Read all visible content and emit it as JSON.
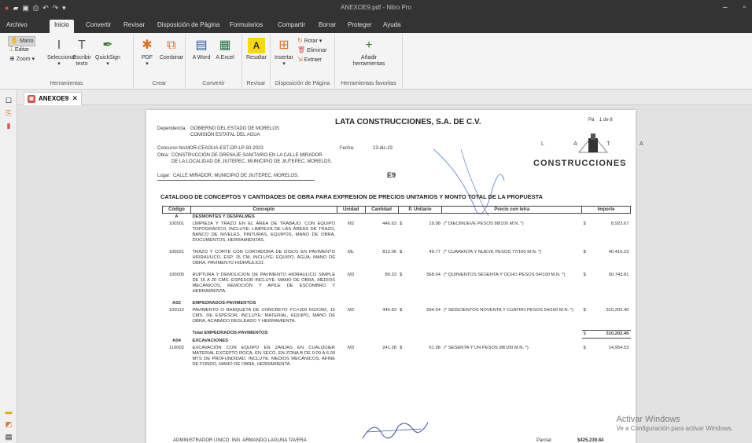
{
  "window": {
    "title": "ANEXOE9.pdf - Nitro Pro",
    "controls": [
      "–",
      "ꟸ",
      "✕"
    ]
  },
  "menu_tabs": [
    "Archivo",
    "Inicio",
    "Convertir",
    "Revisar",
    "Disposición de Página",
    "Formularios",
    "Compartir",
    "Borrar",
    "Proteger",
    "Ayuda"
  ],
  "ribbon": {
    "herramientas": {
      "label": "Herramientas",
      "mano": "Mano",
      "editar": "Editar",
      "zoom": "Zoom",
      "seleccionar": "Seleccionar",
      "escribir_texto": "Escribir texto",
      "quicksign": "QuickSign"
    },
    "crear": {
      "label": "Crear",
      "pdf": "PDF",
      "combinar": "Combinar"
    },
    "convertir": {
      "label": "Convertir",
      "a_word": "A Word",
      "a_excel": "A Excel"
    },
    "revisar": {
      "label": "Revisar",
      "resaltar": "Resaltar"
    },
    "disposicion": {
      "label": "Disposición de Página",
      "insertar": "Insertar",
      "rotar": "Rotar",
      "eliminar": "Eliminar",
      "extraer": "Extraer"
    },
    "favoritas": {
      "label": "Herramientas favoritas",
      "anadir": "Añadir herramientas"
    }
  },
  "doc_tab": {
    "name": "ANEXOE9"
  },
  "pdf": {
    "company": "LATA CONSTRUCCIONES, S.A. DE C.V.",
    "page_label": "Pá",
    "page_of": "1 de 8",
    "dependencia_label": "Dependencia:",
    "dependencia": "GOBIERNO DEL ESTADO DE MORELOS",
    "comision": "COMISIÓN ESTATAL DEL AGUA",
    "concurso_label": "Concurso No.",
    "concurso": "MOR-CEAGUA-EST-OP-LP-50-2023",
    "fecha_label": "Fecha:",
    "fecha": "13-dic-23",
    "obra_label": "Obra:",
    "obra_1": "CONSTRUCCIÓN DE DRENAJE SANITARIO EN LA CALLE MIRADOR",
    "obra_2": "DE LA LOCALIDAD DE JIUTEPEC, MUNICIPIO DE JIUTEPEC, MORELOS.",
    "lugar_label": "Lugar:",
    "lugar": "CALLE MIRADOR, MUNICIPIO DE JIUTEPEC, MORELOS.",
    "doc_code": "E9",
    "logo_text": "CONSTRUCCIONES",
    "logo_letters": "L A T A",
    "catalog_title": "CATALOGO DE CONCEPTOS Y CANTIDADES DE OBRA PARA EXPRESION DE PRECIOS UNITARIOS Y MONTO TOTAL DE LA PROPUESTA",
    "headers": [
      "Código",
      "Concepto",
      "Unidad",
      "Cantidad",
      "P. Unitario",
      "Precio con letra",
      "Importe"
    ],
    "rows": [
      {
        "code": "A",
        "concept": "DESMONTES Y DESPALMES",
        "bold": true
      },
      {
        "code": "100501",
        "concept": "LIMPIEZA Y TRAZO EN EL ÁREA DE TRABAJO. CON EQUIPO TOPOGRÁFICO, INCLUYE: LIMPIEZA DE LAS ÁREAS DE TRAZO, BANCO DE NIVELES, PINTURAS, EQUIPOS, MANO DE OBRA, DOCUMENTOS, HERRAMIENTAS.",
        "unit": "M2",
        "qty": "446.63",
        "cur": "$",
        "pu": "19.98",
        "letter": "(* DIECINUEVE PESOS 98/100 M.N. *)",
        "cur2": "$",
        "amount": "8,923.67"
      },
      {
        "code": "100021",
        "concept": "TRAZO Y CORTE CON CORTADORA DE DISCO EN PAVIMENTO HIDRAULICO, ESP. 15 CM, INCLUYE: EQUIPO, AGUA, MANO DE OBRA, PAVIMENTO HIDRÁULICO.",
        "unit": "ML",
        "qty": "812.06",
        "cur": "$",
        "pu": "49.77",
        "letter": "(* CUARENTA Y NUEVE PESOS 77/100 M.N. *)",
        "cur2": "$",
        "amount": "40,416.23"
      },
      {
        "code": "100005",
        "concept": "RUPTURA Y DEMOLICION DE PAVIMENTO HIDRAULICO SIMPLE DE 15 A 20 CMS. ESPESOR INCLUYE: MANO DE OBRA, MEDIOS MECÁNICOS, REMOCIÓN Y APILE DE ESCOMBRO Y HERRAMIENTA.",
        "unit": "M3",
        "qty": "89.33",
        "cur": "$",
        "pu": "568.04",
        "letter": "(* QUINIENTOS SESENTA Y OCHO PESOS 04/100 M.N. *)",
        "cur2": "$",
        "amount": "50,743.81"
      },
      {
        "code": "A02",
        "concept": "EMPEDRADOS-PAVIMENTOS",
        "bold": true
      },
      {
        "code": "100112",
        "concept": "PAVIMENTO O BANQUETA DE CONCRETO F'C=200 KG/CM2, 15 CMS. DE ESPESOR, INCLUYE: MATERIAL, EQUIPO, MANO DE OBRA, ACABADO REGLEADO Y HERRAMIENTA.",
        "unit": "M2",
        "qty": "446.63",
        "cur": "$",
        "pu": "694.54",
        "letter": "(* SEISCIENTOS NOVENTA Y CUATRO PESOS 54/100 M.N. *)",
        "cur2": "$",
        "amount": "310,202.40"
      },
      {
        "code": "",
        "concept": "Total  EMPEDRADOS-PAVIMENTOS",
        "bold": true,
        "cur2": "$",
        "amount": "310,202.40",
        "total": true
      },
      {
        "code": "A04",
        "concept": "EXCAVACIONES",
        "bold": true
      },
      {
        "code": "110002",
        "concept": "EXCAVACIÓN CON EQUIPO EN ZANJAS EN CUALQUIER MATERIAL EXCEPTO ROCA, EN SECO, EN ZONA B DE 0.00 A 6.00 MTS DE PROFUNDIDAD, INCLUYE: MEDIOS MECÁNICOS, AFINE DE FONDO, MANO DE OBRA, HERRAMIENTA.",
        "unit": "M3",
        "qty": "241.28",
        "cur": "$",
        "pu": "61.98",
        "letter": "(* SESENTA Y UN PESOS 98/100 M.N. *)",
        "cur2": "$",
        "amount": "14,954.53"
      }
    ],
    "admin": "ADMINISTRADOR ÚNICO: ING. ARMANDO LAGUNA TAVERA",
    "parcial_label": "Parcial:",
    "parcial_value": "$425,239.84"
  },
  "watermark": {
    "title": "Activar Windows",
    "subtitle": "Ve a Configuración para activar Windows."
  }
}
